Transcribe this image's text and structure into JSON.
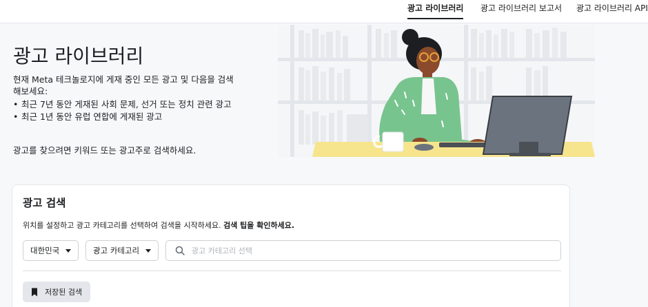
{
  "nav": {
    "tabs": [
      {
        "label": "광고 라이브러리",
        "active": true
      },
      {
        "label": "광고 라이브러리 보고서",
        "active": false
      },
      {
        "label": "광고 라이브러리 API",
        "active": false
      }
    ]
  },
  "hero": {
    "title": "광고 라이브러리",
    "intro": "현재 Meta 테크놀로지에 게재 중인 모든 광고 및 다음을 검색해보세요:",
    "bullets": [
      "최근 7년 동안 게재된 사회 문제, 선거 또는 정치 관련 광고",
      "최근 1년 동안 유럽 연합에 게재된 광고"
    ],
    "footer": "광고를 찾으려면 키워드 또는 광고주로 검색하세요."
  },
  "search": {
    "title": "광고 검색",
    "description": "위치를 설정하고 광고 카테고리를 선택하여 검색을 시작하세요. ",
    "tips_link": "검색 팁을 확인하세요.",
    "country_value": "대한민국",
    "category_value": "광고 카테고리",
    "input_placeholder": "광고 카테고리 선택",
    "saved_searches_label": "저장된 검색"
  },
  "colors": {
    "accent_shirt": "#78c48e",
    "desk": "#f6e58d",
    "monitor": "#6b737e",
    "skin": "#8b4a2b"
  },
  "icons": [
    "search-icon",
    "bookmark-icon",
    "caret-down-icon"
  ]
}
